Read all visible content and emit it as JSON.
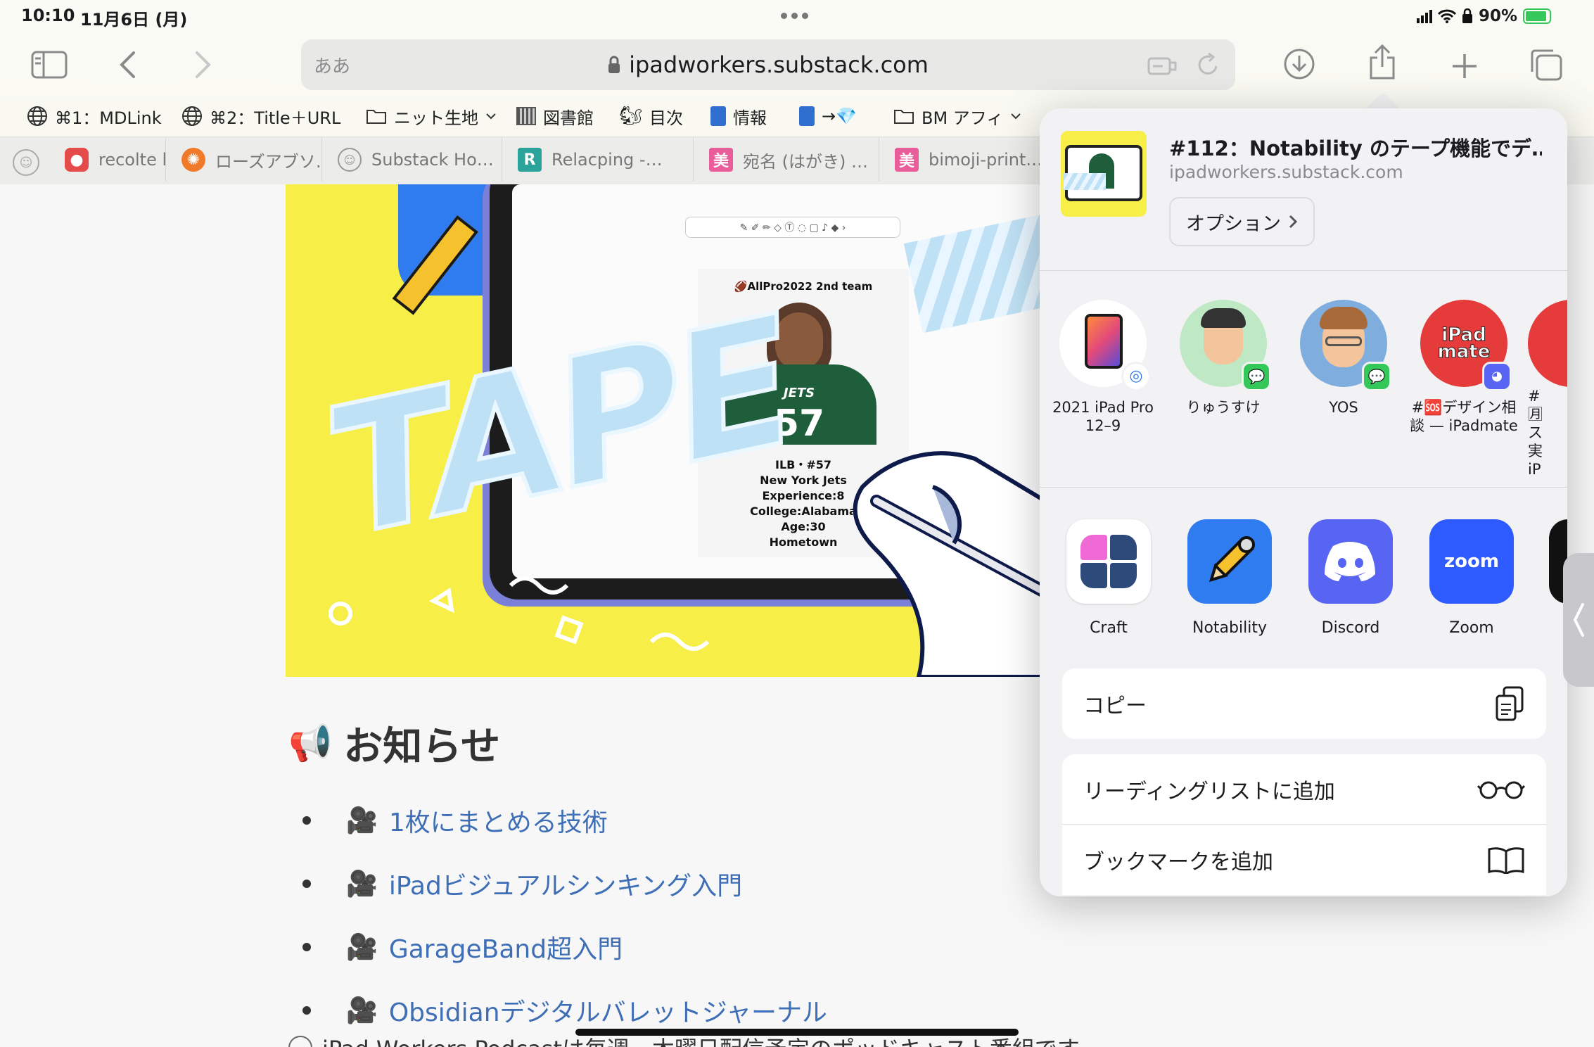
{
  "status": {
    "time": "10:10",
    "date": "11月6日 (月)",
    "battery": "90%",
    "battery_color": "#34c759"
  },
  "toolbar": {
    "aa": "ああ",
    "url": "ipadworkers.substack.com"
  },
  "bookmarks": [
    {
      "icon": "globe-icon",
      "label": "⌘1：MDLink"
    },
    {
      "icon": "globe-icon",
      "label": "⌘2：Title＋URL"
    },
    {
      "icon": "folder-icon",
      "label": "ニット生地"
    },
    {
      "icon": "library-icon",
      "label": "図書館"
    },
    {
      "icon": "squirrel-icon",
      "label": "目次"
    },
    {
      "icon": "book-icon",
      "label": "情報"
    },
    {
      "icon": "book-icon",
      "label": "→💎"
    },
    {
      "icon": "folder-icon",
      "label": "BM アフィ"
    }
  ],
  "tabs": [
    {
      "label": "recolte l",
      "favicon": "#e54b4b"
    },
    {
      "label": "ローズアブソ…",
      "favicon": "#f07a2a"
    },
    {
      "label": "Substack Ho…",
      "favicon": "#9a9a9a"
    },
    {
      "label": "Relacping -…",
      "favicon": "#2aa39a",
      "letter": "R"
    },
    {
      "label": "宛名 (はがき) …",
      "favicon": "#e85d9a",
      "letter": "美"
    },
    {
      "label": "bimoji-print.…",
      "favicon": "#e85d9a",
      "letter": "美"
    }
  ],
  "hero": {
    "tape_text": "TAPE",
    "card_title": "🏈AllPro2022 2nd team",
    "card_lines": [
      "ILB・#57",
      "New York Jets",
      "Experience:8",
      "College:Alabama",
      "Age:30",
      "Hometown"
    ],
    "jersey": "JETS"
  },
  "article": {
    "heading": "お知らせ",
    "items": [
      "1枚にまとめる技術",
      "iPadビジュアルシンキング入門",
      "GarageBand超入門",
      "Obsidianデジタルバレットジャーナル"
    ],
    "footer": "iPad Workers Podcastは毎週、木曜日配信予定のポッドキャスト番組です"
  },
  "share": {
    "title": "#112：Notability のテープ機能でデ…",
    "domain": "ipadworkers.substack.com",
    "options": "オプション",
    "people": [
      {
        "name": "2021 iPad Pro 12–9"
      },
      {
        "name": "りゅうすけ"
      },
      {
        "name": "YOS"
      },
      {
        "name": "#🆘デザイン相談 — iPadmate",
        "avatar_text": "iPad mate"
      },
      {
        "name": "# 🈷 ス 実 iP"
      }
    ],
    "apps": [
      {
        "name": "Craft"
      },
      {
        "name": "Notability"
      },
      {
        "name": "Discord"
      },
      {
        "name": "Zoom",
        "logo": "zoom"
      }
    ],
    "actions": [
      {
        "label": "コピー",
        "icon": "copy-icon"
      },
      {
        "label": "リーディングリストに追加",
        "icon": "glasses-icon"
      },
      {
        "label": "ブックマークを追加",
        "icon": "book-open-icon"
      }
    ]
  }
}
